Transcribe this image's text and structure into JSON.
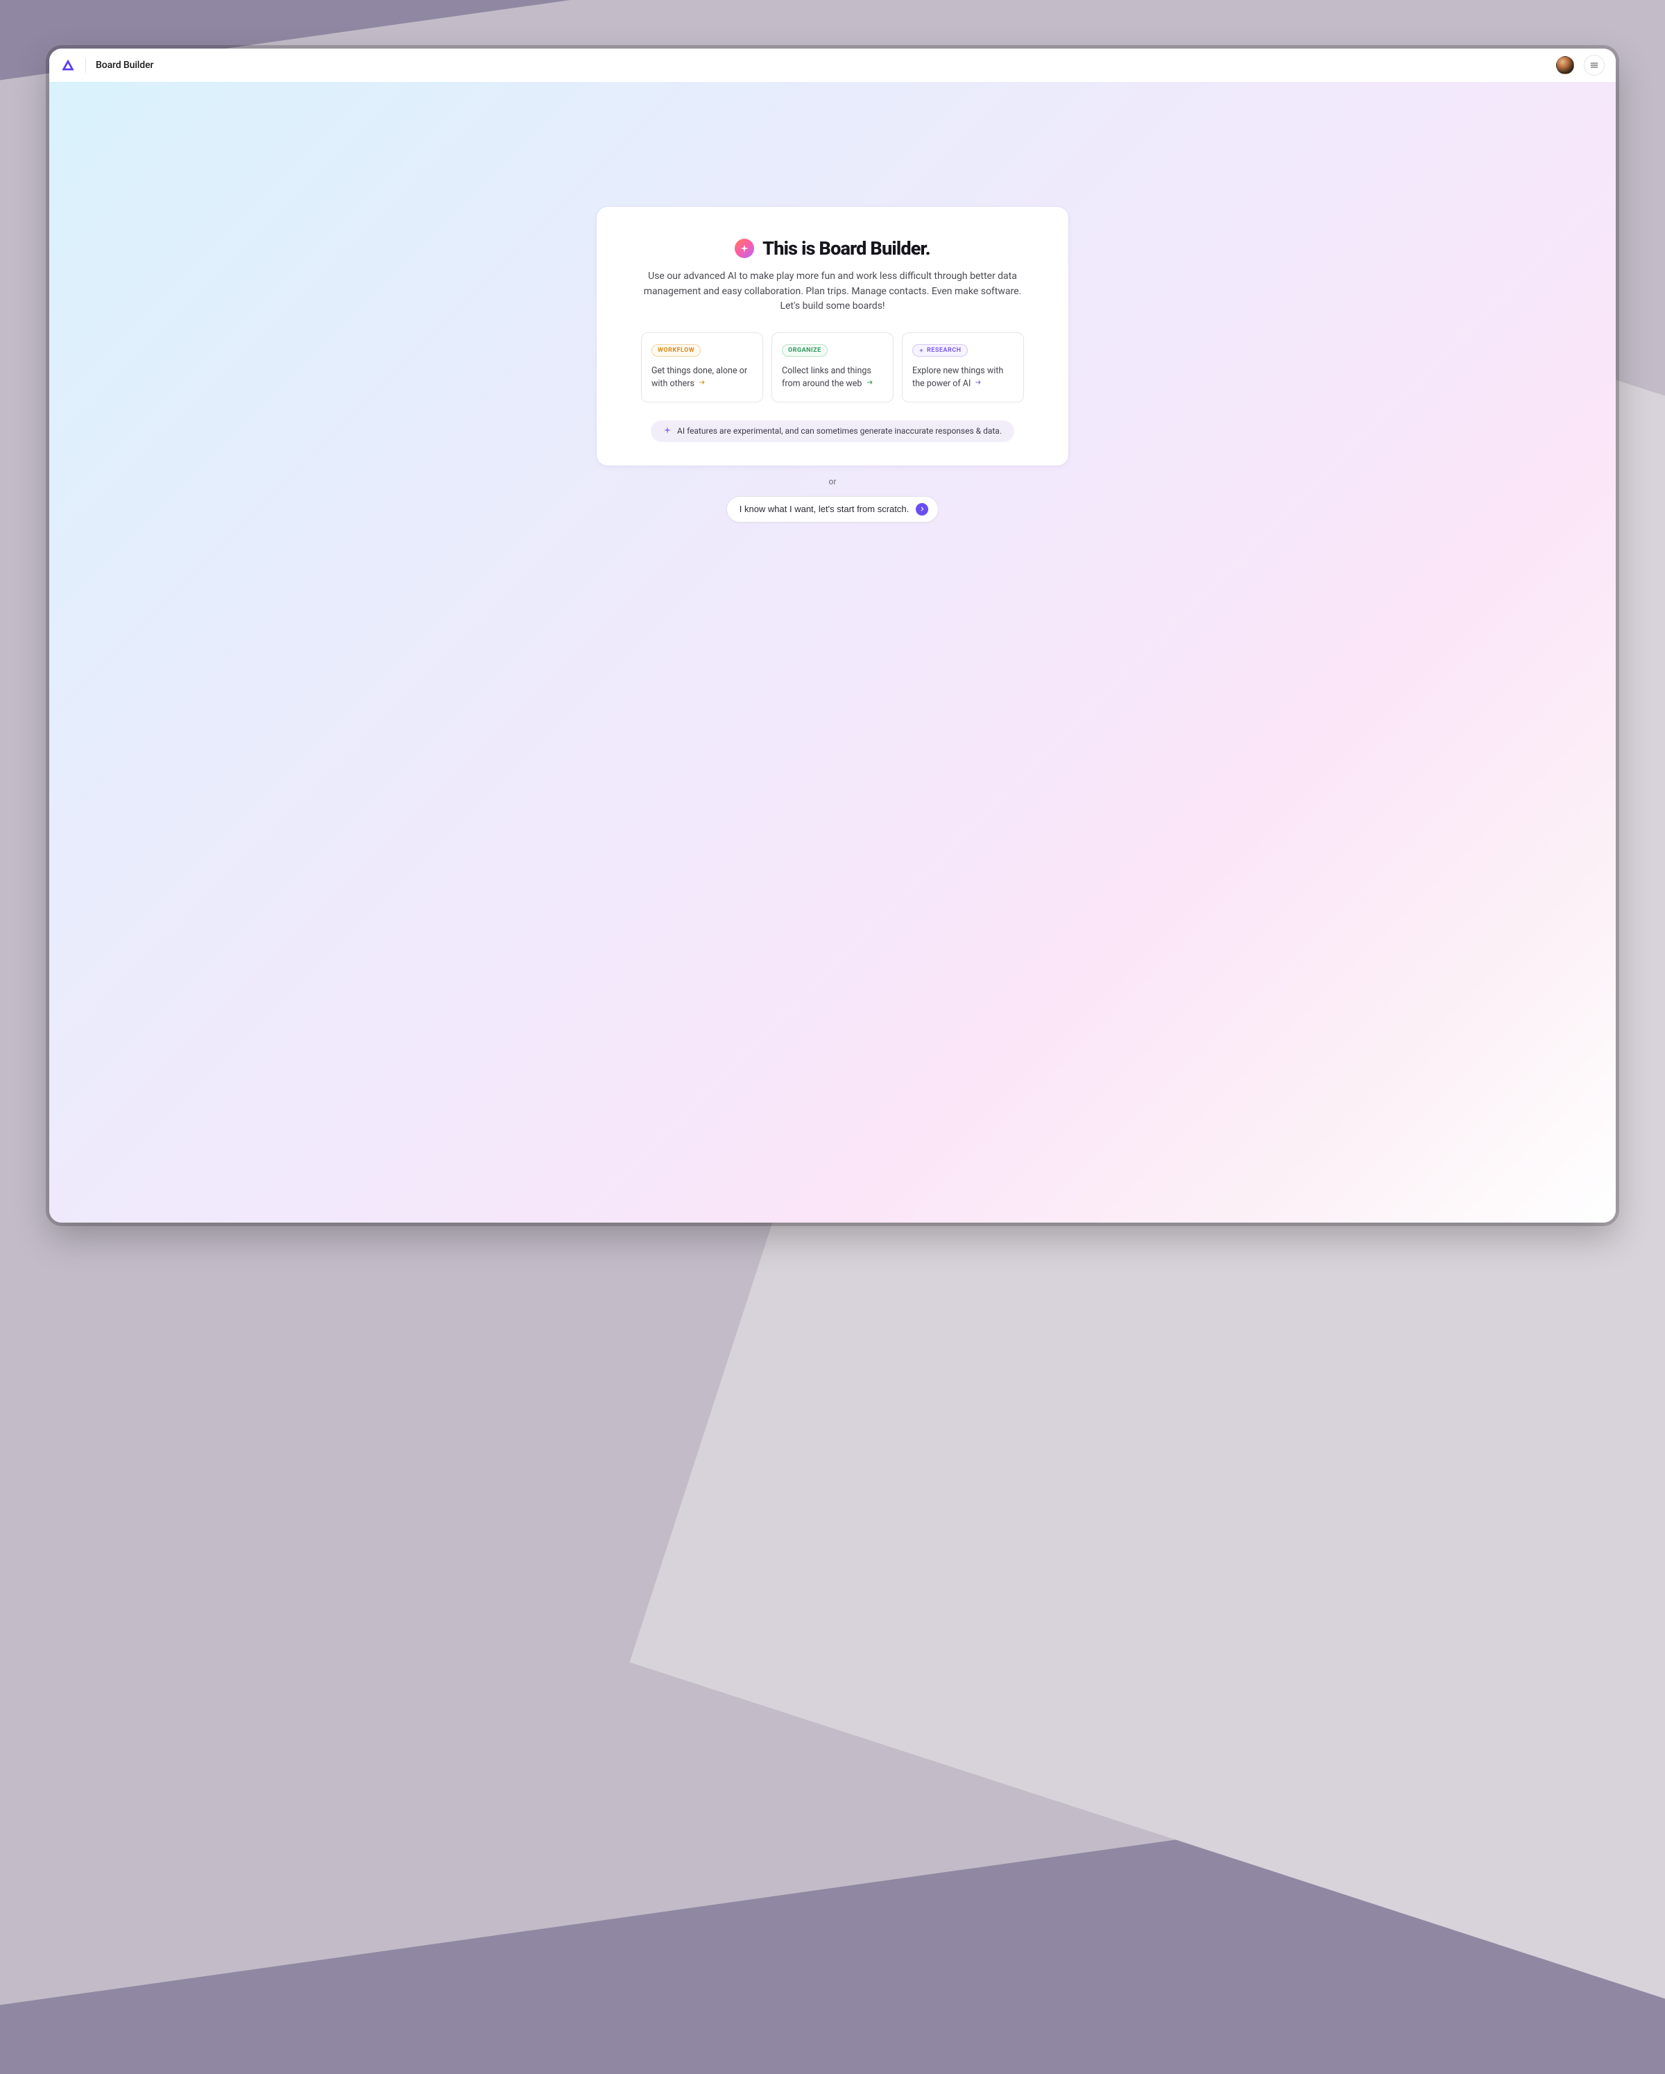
{
  "header": {
    "app_title": "Board Builder"
  },
  "hero": {
    "title": "This is Board Builder.",
    "subtitle": "Use our advanced AI to make play more fun and work less difficult through better data management and easy collaboration. Plan trips. Manage contacts. Even make software. Let's build some boards!"
  },
  "cards": [
    {
      "tag": "WORKFLOW",
      "text": "Get things done, alone or with others"
    },
    {
      "tag": "ORGANIZE",
      "text": "Collect links and things from around the web"
    },
    {
      "tag": "RESEARCH",
      "text": "Explore new things with the power of AI"
    }
  ],
  "ai_notice": "AI features are experimental, and can sometimes generate inaccurate responses & data.",
  "or_text": "or",
  "scratch_label": "I know what I want, let's start from scratch."
}
